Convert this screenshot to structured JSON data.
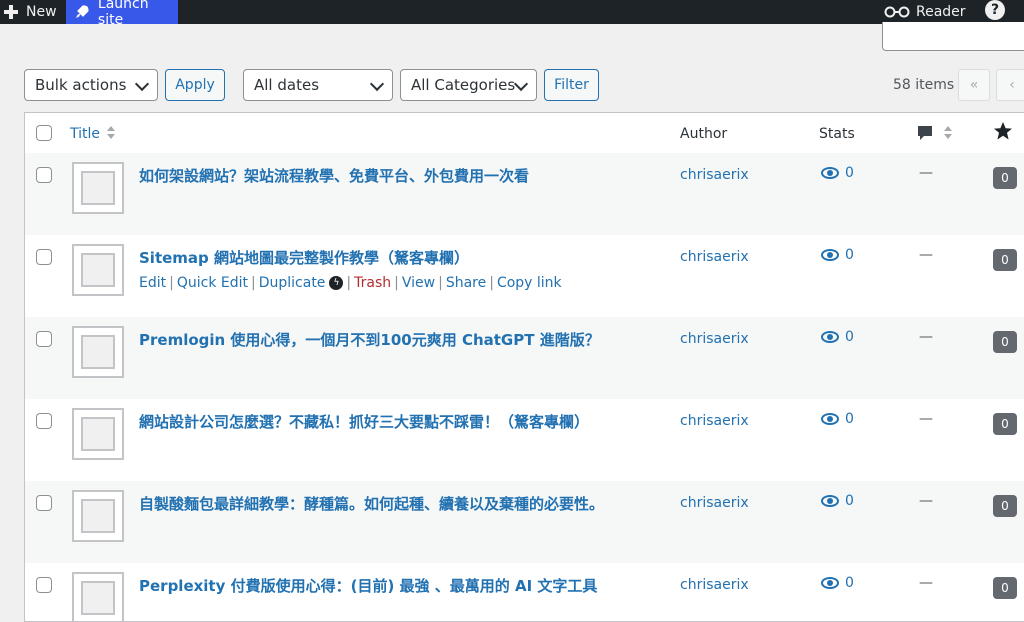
{
  "adminbar": {
    "new_label": "New",
    "launch_label": "Launch site",
    "reader_label": "Reader",
    "help_label": "?"
  },
  "toolbar": {
    "bulk_actions": "Bulk actions",
    "apply_label": "Apply",
    "dates": "All dates",
    "categories": "All Categories",
    "filter_label": "Filter",
    "items_count": "58 items",
    "first_page": "«",
    "prev_page": "‹"
  },
  "columns": {
    "title": "Title",
    "author": "Author",
    "stats": "Stats"
  },
  "posts": [
    {
      "title": "如何架設網站？架站流程教學、免費平台、外包費用一次看",
      "author": "chrisaerix",
      "views": "0",
      "comments": "—",
      "count": "0"
    },
    {
      "title": "Sitemap 網站地圖最完整製作教學（駑客專欄）",
      "author": "chrisaerix",
      "views": "0",
      "comments": "—",
      "count": "0"
    },
    {
      "title": "Premlogin 使用心得，一個月不到100元爽用 ChatGPT 進階版？",
      "author": "chrisaerix",
      "views": "0",
      "comments": "—",
      "count": "0"
    },
    {
      "title": "網站設計公司怎麼選？不藏私！抓好三大要點不踩雷！（駑客專欄）",
      "author": "chrisaerix",
      "views": "0",
      "comments": "—",
      "count": "0"
    },
    {
      "title": "自製酸麵包最詳細教學：酵種篇。如何起種、續養以及棄種的必要性。",
      "author": "chrisaerix",
      "views": "0",
      "comments": "—",
      "count": "0"
    },
    {
      "title": "Perplexity 付費版使用心得：(目前) 最強 、最萬用的 AI 文字工具",
      "author": "chrisaerix",
      "views": "0",
      "comments": "—",
      "count": "0"
    }
  ],
  "row_actions": {
    "edit": "Edit",
    "quick_edit": "Quick Edit",
    "duplicate": "Duplicate",
    "trash": "Trash",
    "view": "View",
    "share": "Share",
    "copy_link": "Copy link"
  },
  "colors": {
    "accent": "#2271b1",
    "adminbar": "#1d2327",
    "launch": "#3858e9",
    "trash": "#b32d2e"
  }
}
